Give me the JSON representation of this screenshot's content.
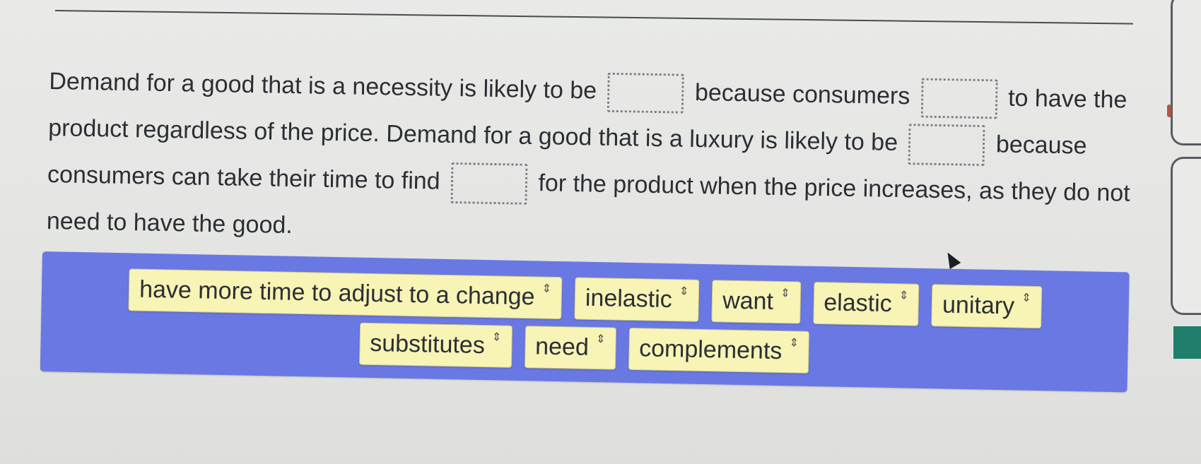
{
  "question": {
    "s1_a": "Demand for a good that is a necessity is likely to be",
    "s1_b": "because consumers",
    "s1_c": "to have the product regardless of the price.",
    "s2_a": "Demand for a good that is a luxury is likely to be",
    "s2_b": "because consumers can take their time to find",
    "s2_c": "for the product when the price increases, as they do not need to have the good."
  },
  "word_bank": {
    "chips": [
      "have more time to adjust to a change",
      "inelastic",
      "want",
      "elastic",
      "unitary",
      "substitutes",
      "need",
      "complements"
    ],
    "drag_glyph": "⇕"
  },
  "colors": {
    "bank_background": "#6a78e4",
    "chip_background": "#f7f4b5",
    "teal_accent": "#1f7d6b"
  }
}
